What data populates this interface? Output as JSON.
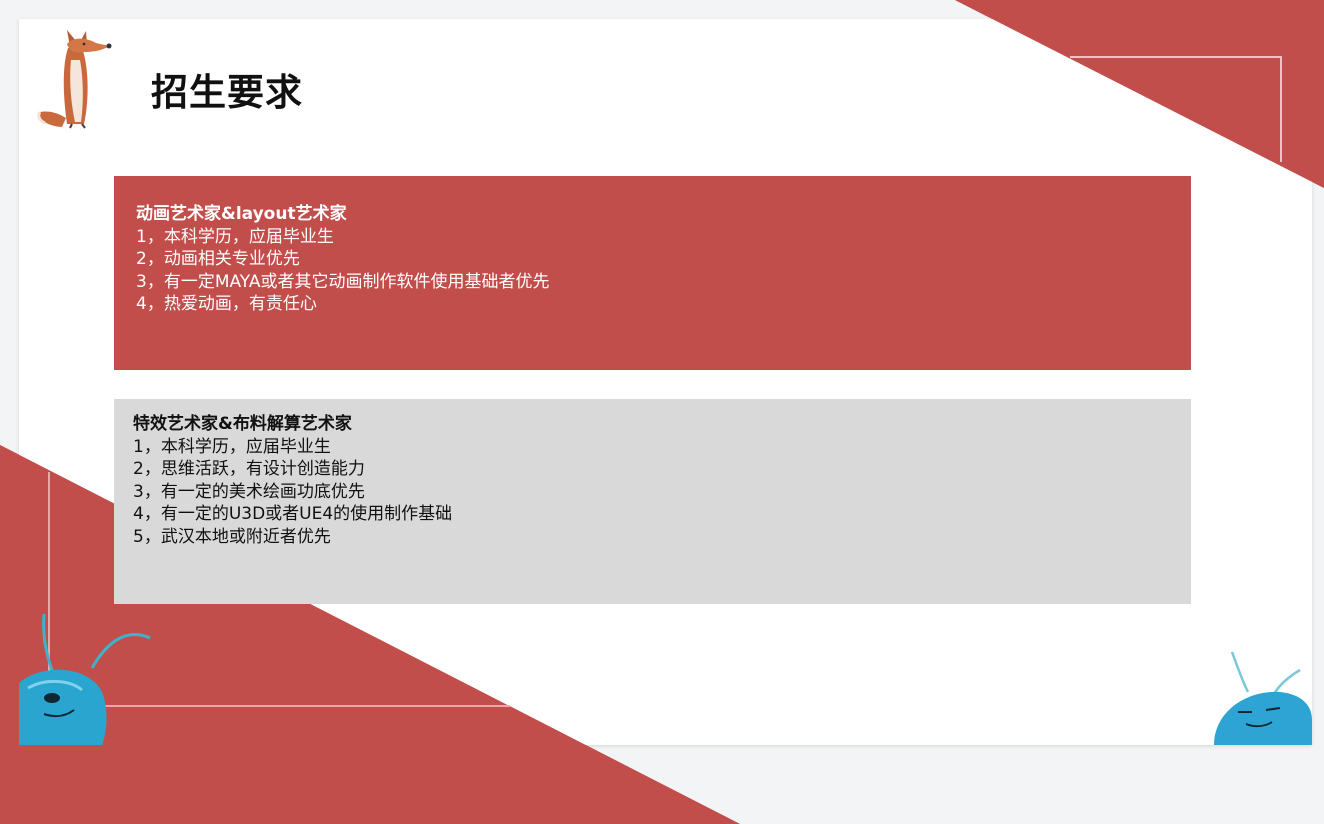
{
  "title": "招生要求",
  "colors": {
    "accent_red": "#c24e4b",
    "panel_gray": "#d9d9d9",
    "slide_white": "#ffffff",
    "background": "#f3f4f6"
  },
  "sections": [
    {
      "heading": "动画艺术家&layout艺术家",
      "items": [
        "1，本科学历，应届毕业生",
        "2，动画相关专业优先",
        "3，有一定MAYA或者其它动画制作软件使用基础者优先",
        "4，热爱动画，有责任心"
      ]
    },
    {
      "heading": "特效艺术家&布料解算艺术家",
      "items": [
        "1，本科学历，应届毕业生",
        "2，思维活跃，有设计创造能力",
        "3，有一定的美术绘画功底优先",
        "4，有一定的U3D或者UE4的使用制作基础",
        "5，武汉本地或附近者优先"
      ]
    }
  ],
  "icons": {
    "mascot": "fox-illustration",
    "left_creature": "blue-creature-illustration",
    "right_creature": "blue-creature-illustration"
  }
}
